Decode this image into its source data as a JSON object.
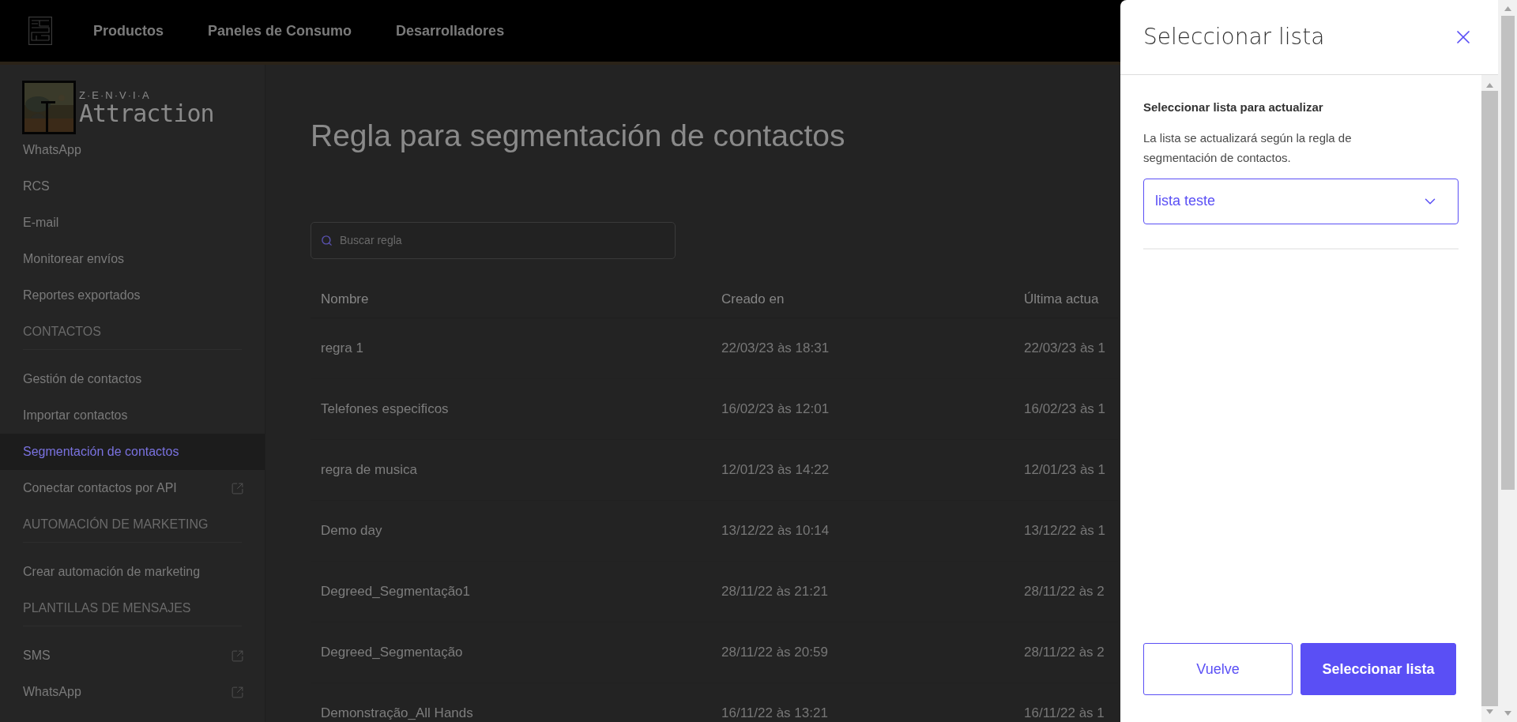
{
  "header": {
    "nav": [
      {
        "label": "Productos"
      },
      {
        "label": "Paneles de Consumo"
      },
      {
        "label": "Desarrolladores"
      }
    ]
  },
  "sidebar": {
    "brand": {
      "tagline": "Z·E·N·V·I·A",
      "name": "Attraction"
    },
    "groups": [
      {
        "items": [
          {
            "label": "WhatsApp",
            "selected": false,
            "external": false
          },
          {
            "label": "RCS",
            "selected": false,
            "external": false
          },
          {
            "label": "E-mail",
            "selected": false,
            "external": false
          },
          {
            "label": "Monitorear envíos",
            "selected": false,
            "external": false
          },
          {
            "label": "Reportes exportados",
            "selected": false,
            "external": false
          }
        ]
      },
      {
        "heading": "CONTACTOS",
        "items": [
          {
            "label": "Gestión de contactos",
            "selected": false,
            "external": false
          },
          {
            "label": "Importar contactos",
            "selected": false,
            "external": false
          },
          {
            "label": "Segmentación de contactos",
            "selected": true,
            "external": false
          },
          {
            "label": "Conectar contactos por API",
            "selected": false,
            "external": true
          }
        ]
      },
      {
        "heading": "AUTOMACIÓN DE MARKETING",
        "items": [
          {
            "label": "Crear automación de marketing",
            "selected": false,
            "external": false
          }
        ]
      },
      {
        "heading": "PLANTILLAS DE MENSAJES",
        "items": [
          {
            "label": "SMS",
            "selected": false,
            "external": true
          },
          {
            "label": "WhatsApp",
            "selected": false,
            "external": true
          }
        ]
      }
    ]
  },
  "page": {
    "title": "Regla para segmentación de contactos",
    "search": {
      "placeholder": "Buscar regla"
    },
    "table": {
      "columns": [
        "Nombre",
        "Creado en",
        "Última actua"
      ],
      "rows": [
        [
          "regra 1",
          "22/03/23 às 18:31",
          "22/03/23 às 1"
        ],
        [
          "Telefones especificos",
          "16/02/23 às 12:01",
          "16/02/23 às 1"
        ],
        [
          "regra de musica",
          "12/01/23 às 14:22",
          "12/01/23 às 1"
        ],
        [
          "Demo day",
          "13/12/22 às 10:14",
          "13/12/22 às 1"
        ],
        [
          "Degreed_Segmentação1",
          "28/11/22 às 21:21",
          "28/11/22 às 2"
        ],
        [
          "Degreed_Segmentação",
          "28/11/22 às 20:59",
          "28/11/22 às 2"
        ],
        [
          "Demonstração_All Hands",
          "16/11/22 às 13:21",
          "16/11/22 às 1"
        ]
      ]
    }
  },
  "drawer": {
    "title": "Seleccionar lista",
    "subtitle": "Seleccionar lista para actualizar",
    "description": "La lista se actualizará según la regla de segmentación de contactos.",
    "select": {
      "value": "lista teste"
    },
    "buttons": [
      {
        "label": "Vuelve",
        "kind": "secondary"
      },
      {
        "label": "Seleccionar lista",
        "kind": "primary"
      }
    ]
  }
}
